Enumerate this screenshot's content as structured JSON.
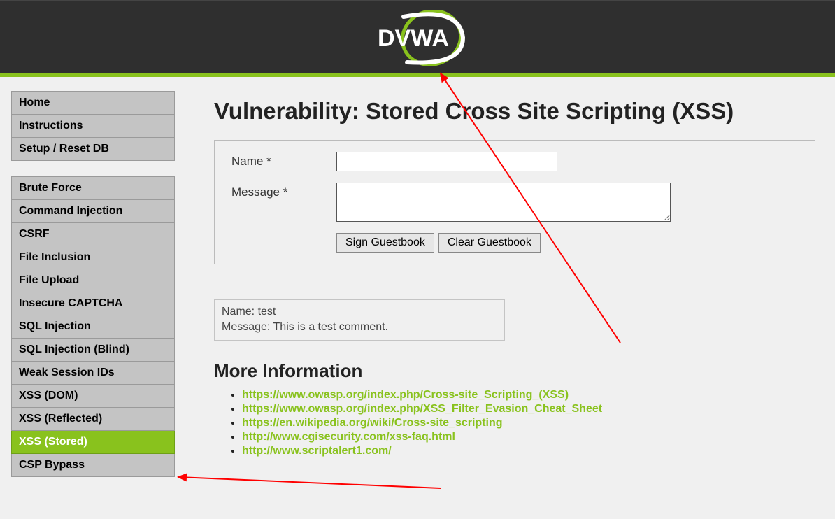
{
  "logo_text": "DVWA",
  "sidebar": {
    "groups": [
      {
        "items": [
          {
            "label": "Home",
            "active": false
          },
          {
            "label": "Instructions",
            "active": false
          },
          {
            "label": "Setup / Reset DB",
            "active": false
          }
        ]
      },
      {
        "items": [
          {
            "label": "Brute Force",
            "active": false
          },
          {
            "label": "Command Injection",
            "active": false
          },
          {
            "label": "CSRF",
            "active": false
          },
          {
            "label": "File Inclusion",
            "active": false
          },
          {
            "label": "File Upload",
            "active": false
          },
          {
            "label": "Insecure CAPTCHA",
            "active": false
          },
          {
            "label": "SQL Injection",
            "active": false
          },
          {
            "label": "SQL Injection (Blind)",
            "active": false
          },
          {
            "label": "Weak Session IDs",
            "active": false
          },
          {
            "label": "XSS (DOM)",
            "active": false
          },
          {
            "label": "XSS (Reflected)",
            "active": false
          },
          {
            "label": "XSS (Stored)",
            "active": true
          },
          {
            "label": "CSP Bypass",
            "active": false
          }
        ]
      }
    ]
  },
  "page": {
    "title": "Vulnerability: Stored Cross Site Scripting (XSS)",
    "form": {
      "name_label": "Name *",
      "name_value": "",
      "message_label": "Message *",
      "message_value": "",
      "sign_button": "Sign Guestbook",
      "clear_button": "Clear Guestbook"
    },
    "comment": {
      "name_label": "Name:",
      "name_value": "test",
      "message_label": "Message:",
      "message_value": "This is a test comment."
    },
    "more_info_heading": "More Information",
    "links": [
      "https://www.owasp.org/index.php/Cross-site_Scripting_(XSS)",
      "https://www.owasp.org/index.php/XSS_Filter_Evasion_Cheat_Sheet",
      "https://en.wikipedia.org/wiki/Cross-site_scripting",
      "http://www.cgisecurity.com/xss-faq.html",
      "http://www.scriptalert1.com/"
    ]
  }
}
